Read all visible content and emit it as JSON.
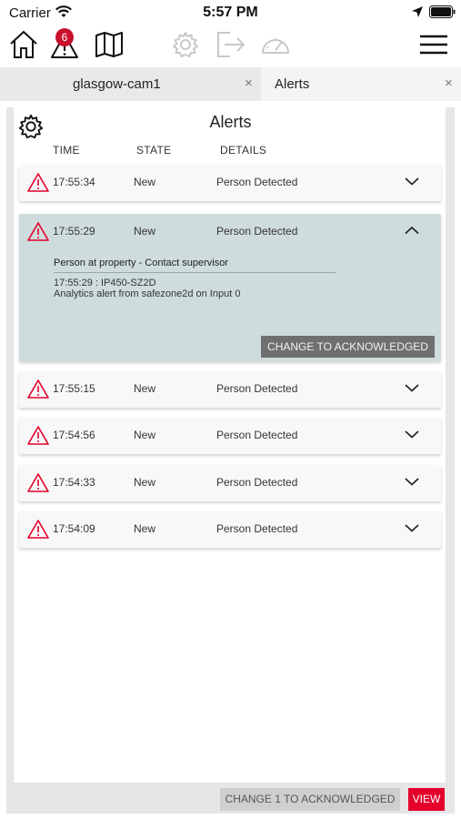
{
  "status_bar": {
    "carrier": "Carrier",
    "time": "5:57 PM",
    "icons": [
      "wifi-icon",
      "location-arrow-icon",
      "battery-icon"
    ]
  },
  "toolbar": {
    "icons": [
      "home-icon",
      "alert-warning-icon",
      "map-icon",
      "settings-gear-icon",
      "logout-icon",
      "gauge-icon",
      "hamburger-menu-icon"
    ],
    "alert_badge_count": "6",
    "disabled_icons": [
      "settings-gear-icon",
      "logout-icon",
      "gauge-icon"
    ]
  },
  "tabs": [
    {
      "label": "glasgow-cam1",
      "close": "×",
      "active": false
    },
    {
      "label": "Alerts",
      "close": "×",
      "active": true
    }
  ],
  "panel": {
    "title": "Alerts",
    "columns": {
      "time": "TIME",
      "state": "STATE",
      "details": "DETAILS"
    }
  },
  "alerts": [
    {
      "time": "17:55:34",
      "state": "New",
      "details": "Person Detected",
      "expanded": false
    },
    {
      "time": "17:55:29",
      "state": "New",
      "details": "Person Detected",
      "expanded": true,
      "expanded_title": "Person at property - Contact supervisor",
      "expanded_line1": "17:55:29 : IP450-SZ2D",
      "expanded_line2": "Analytics alert from safezone2d on Input 0",
      "ack_label": "CHANGE TO ACKNOWLEDGED"
    },
    {
      "time": "17:55:15",
      "state": "New",
      "details": "Person Detected",
      "expanded": false
    },
    {
      "time": "17:54:56",
      "state": "New",
      "details": "Person Detected",
      "expanded": false
    },
    {
      "time": "17:54:33",
      "state": "New",
      "details": "Person Detected",
      "expanded": false
    },
    {
      "time": "17:54:09",
      "state": "New",
      "details": "Person Detected",
      "expanded": false
    }
  ],
  "footer": {
    "bulk_ack_label": "CHANGE 1 TO ACKNOWLEDGED",
    "view_label": "VIEW"
  },
  "colors": {
    "alert_red": "#e4002b",
    "expanded_row_bg": "#cfdcdd",
    "badge_red": "#c8102e",
    "ack_button_bg": "#6f6f6f"
  }
}
